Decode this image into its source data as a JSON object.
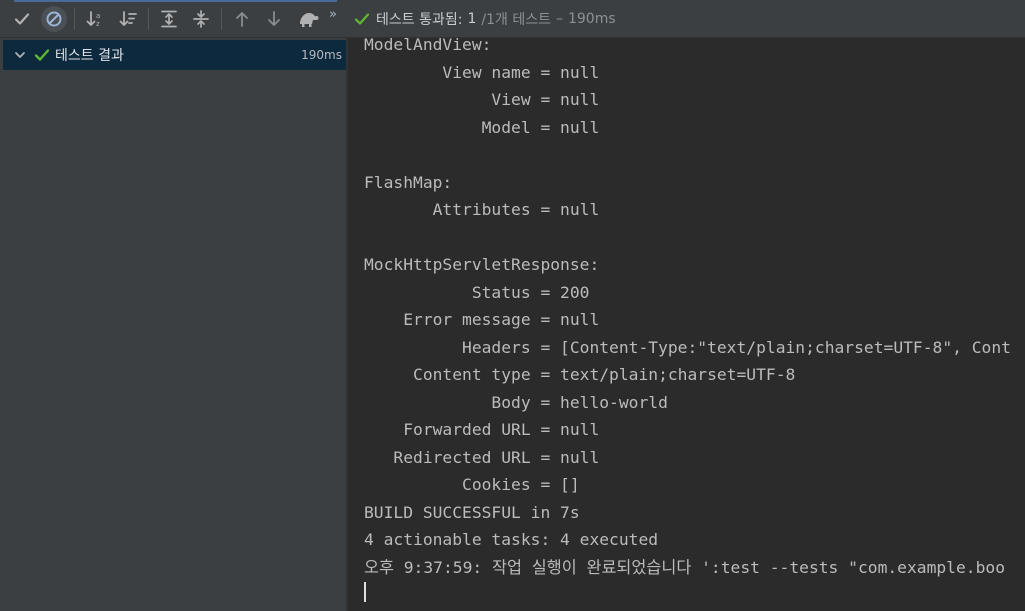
{
  "toolbar": {
    "buttons": [
      {
        "name": "show-passed-button",
        "icon": "check-icon"
      },
      {
        "name": "show-ignored-button",
        "icon": "ban-icon"
      },
      {
        "name": "sort-alphabetically-button",
        "icon": "sort-az-icon"
      },
      {
        "name": "sort-by-duration-button",
        "icon": "sort-duration-icon"
      },
      {
        "name": "expand-all-button",
        "icon": "expand-all-icon"
      },
      {
        "name": "collapse-all-button",
        "icon": "collapse-all-icon"
      },
      {
        "name": "previous-failed-button",
        "icon": "arrow-up-icon"
      },
      {
        "name": "next-failed-button",
        "icon": "arrow-down-icon"
      },
      {
        "name": "import-tests-button",
        "icon": "turtle-icon"
      }
    ],
    "more": "»",
    "status": {
      "label": "테스트 통과됨:",
      "count": "1",
      "total": "/1개 테스트",
      "dash": "–",
      "time": "190ms"
    }
  },
  "colors": {
    "pass_green": "#5fb832",
    "selection": "#0d293e",
    "toolbar_bg": "#3c3f41",
    "console_bg": "#2b2b2b"
  },
  "tree": {
    "root": {
      "label": "테스트 결과",
      "time": "190ms",
      "status": "passed"
    }
  },
  "console": {
    "lines": [
      "ModelAndView:",
      "        View name = null",
      "             View = null",
      "            Model = null",
      "",
      "FlashMap:",
      "       Attributes = null",
      "",
      "MockHttpServletResponse:",
      "           Status = 200",
      "    Error message = null",
      "          Headers = [Content-Type:\"text/plain;charset=UTF-8\", Cont",
      "     Content type = text/plain;charset=UTF-8",
      "             Body = hello-world",
      "    Forwarded URL = null",
      "   Redirected URL = null",
      "          Cookies = []",
      "BUILD SUCCESSFUL in 7s",
      "4 actionable tasks: 4 executed",
      "오후 9:37:59: 작업 실행이 완료되었습니다 ':test --tests \"com.example.boo"
    ]
  }
}
